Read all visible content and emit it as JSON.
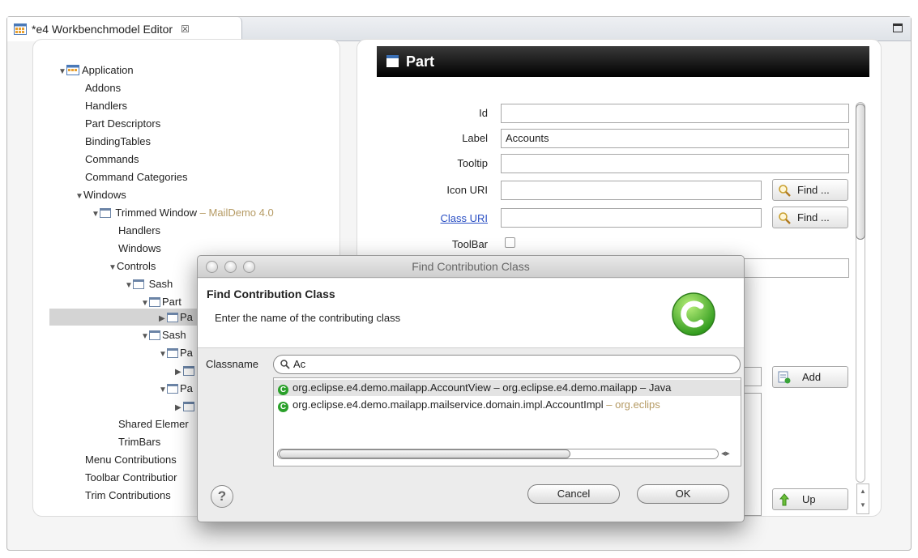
{
  "tab": {
    "label": "*e4 Workbenchmodel Editor",
    "close": "☒"
  },
  "tree": {
    "items": [
      {
        "label": "Application"
      },
      {
        "label": "Addons"
      },
      {
        "label": "Handlers"
      },
      {
        "label": "Part Descriptors"
      },
      {
        "label": "BindingTables"
      },
      {
        "label": "Commands"
      },
      {
        "label": "Command Categories"
      },
      {
        "label": "Windows"
      },
      {
        "label": "Trimmed Window",
        "suffix": " – MailDemo 4.0"
      },
      {
        "label": "Handlers"
      },
      {
        "label": "Windows"
      },
      {
        "label": "Controls"
      },
      {
        "label": "Sash"
      },
      {
        "label": "Part"
      },
      {
        "label": "Pa"
      },
      {
        "label": "Sash"
      },
      {
        "label": "Pa"
      },
      {
        "label": ""
      },
      {
        "label": "Pa"
      },
      {
        "label": ""
      },
      {
        "label": "Shared Elemer"
      },
      {
        "label": "TrimBars"
      },
      {
        "label": "Menu Contributions"
      },
      {
        "label": "Toolbar Contributior"
      },
      {
        "label": "Trim Contributions"
      }
    ]
  },
  "detail": {
    "title": "Part",
    "fields": {
      "id_label": "Id",
      "id_value": "",
      "label_label": "Label",
      "label_value": "Accounts",
      "tooltip_label": "Tooltip",
      "tooltip_value": "",
      "icon_label": "Icon URI",
      "icon_value": "",
      "class_label": "Class URI",
      "class_value": "",
      "toolbar_label": "ToolBar"
    },
    "find_label": "Find ...",
    "add_label": "Add",
    "up_label": "Up"
  },
  "dialog": {
    "window_title": "Find Contribution Class",
    "heading": "Find Contribution Class",
    "subtitle": "Enter the name of the contributing class",
    "classname_label": "Classname",
    "search_value": "Ac",
    "results": [
      {
        "main": "org.eclipse.e4.demo.mailapp.AccountView – org.eclipse.e4.demo.mailapp – Java",
        "suffix": ""
      },
      {
        "main": "org.eclipse.e4.demo.mailapp.mailservice.domain.impl.AccountImpl",
        "suffix": " – org.eclips"
      }
    ],
    "cancel_label": "Cancel",
    "ok_label": "OK",
    "help_label": "?"
  },
  "colors": {
    "accent": "#2a4fc4",
    "selection": "#d4d4d4",
    "header": "#000000"
  }
}
